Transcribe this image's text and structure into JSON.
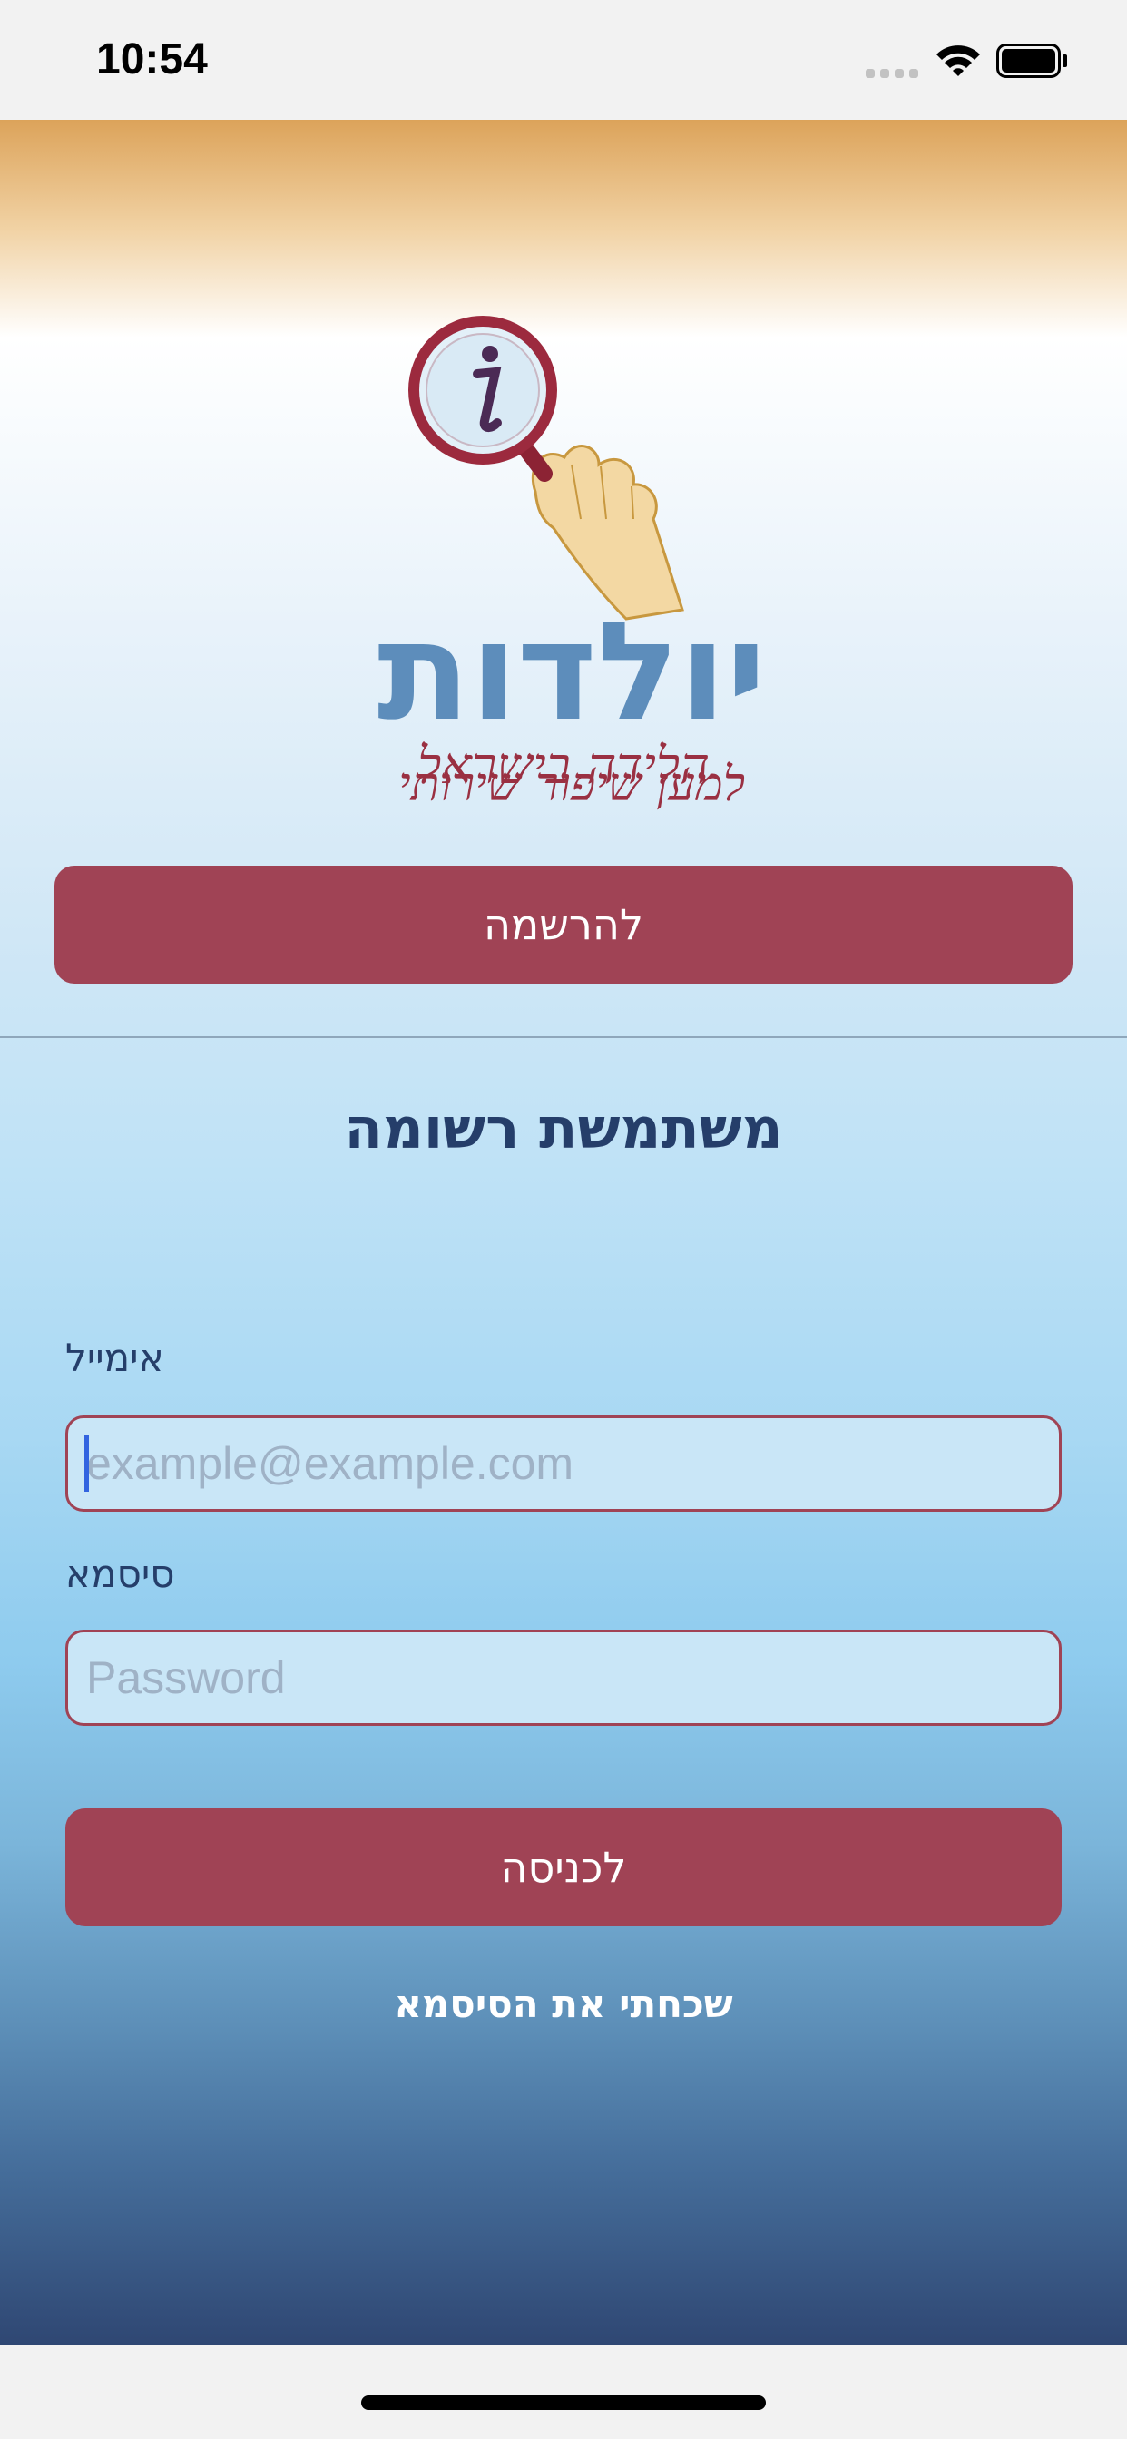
{
  "status_bar": {
    "time": "10:54",
    "signal_icon": "signal-dots-icon",
    "wifi_icon": "wifi-icon",
    "battery_icon": "battery-full-icon"
  },
  "logo": {
    "icon": "magnifier-info-logo",
    "brand_name": "יולדות",
    "tagline_line1": "למען שיפור שירותי",
    "tagline_line2": "הלידה בישראל"
  },
  "register_button": {
    "label": "להרשמה"
  },
  "login_section": {
    "title": "משתמשת רשומה",
    "email": {
      "label": "אימייל",
      "value": "",
      "placeholder": "example@example.com"
    },
    "password": {
      "label": "סיסמא",
      "value": "",
      "placeholder": "Password"
    },
    "login_button": {
      "label": "לכניסה"
    },
    "forgot_link": {
      "label": "שכחתי את הסיסמא"
    }
  },
  "colors": {
    "button": "#a04355",
    "title_text": "#253e6a",
    "field_border": "#a04355",
    "field_bg": "#c9e6f7"
  }
}
